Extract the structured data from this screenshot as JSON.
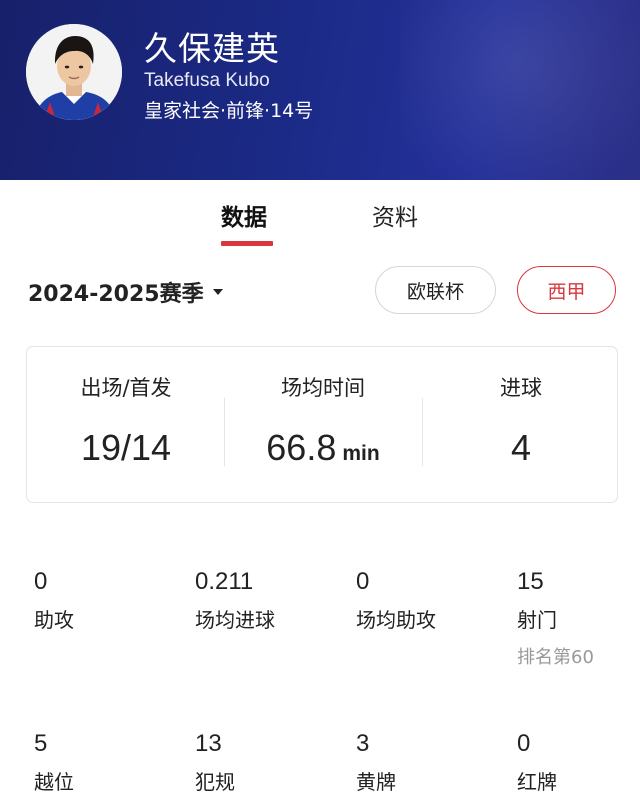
{
  "player": {
    "name_cn": "久保建英",
    "name_en": "Takefusa Kubo",
    "team_position_number": "皇家社会·前锋·14号"
  },
  "tabs": [
    {
      "label": "数据",
      "active": true
    },
    {
      "label": "资料",
      "active": false
    }
  ],
  "season": {
    "label": "2024-2025赛季",
    "competitions": [
      {
        "label": "欧联杯",
        "selected": false
      },
      {
        "label": "西甲",
        "selected": true
      }
    ]
  },
  "summary": [
    {
      "label": "出场/首发",
      "value": "19/14",
      "unit": ""
    },
    {
      "label": "场均时间",
      "value": "66.8",
      "unit": "min"
    },
    {
      "label": "进球",
      "value": "4",
      "unit": ""
    }
  ],
  "stats_row1": [
    {
      "value": "0",
      "label": "助攻"
    },
    {
      "value": "0.211",
      "label": "场均进球"
    },
    {
      "value": "0",
      "label": "场均助攻"
    },
    {
      "value": "15",
      "label": "射门",
      "rank": "排名第60"
    }
  ],
  "stats_row2": [
    {
      "value": "5",
      "label": "越位"
    },
    {
      "value": "13",
      "label": "犯规"
    },
    {
      "value": "3",
      "label": "黄牌"
    },
    {
      "value": "0",
      "label": "红牌"
    }
  ],
  "colors": {
    "header_bg": "#1b2a86",
    "accent_red": "#d9363e",
    "muted_text": "#999999"
  }
}
